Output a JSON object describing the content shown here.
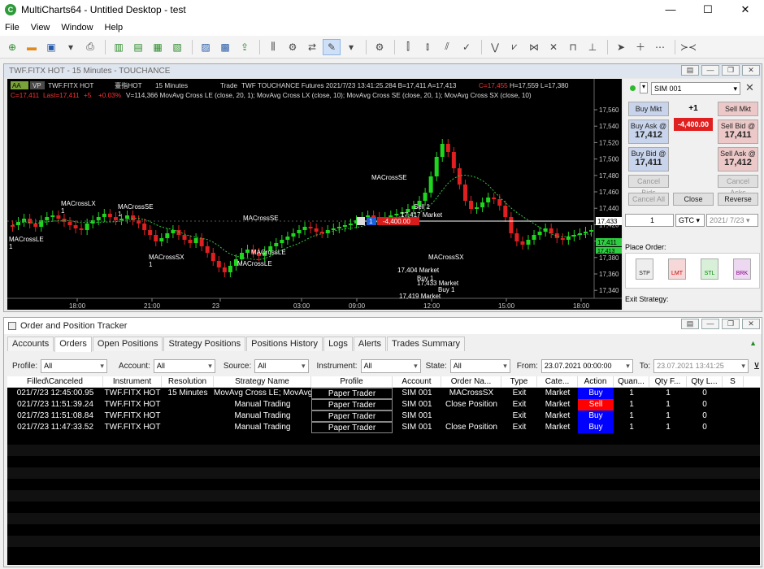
{
  "title": "MultiCharts64 - Untitled Desktop - test",
  "menu": [
    "File",
    "View",
    "Window",
    "Help"
  ],
  "chart_window": {
    "title": "TWF.FITX HOT - 15 Minutes - TOUCHANCE",
    "aa": "AA",
    "vp": "VP",
    "hdr_symbol": "TWF.FITX HOT",
    "hdr_name": "臺指HOT",
    "hdr_res": "15 Minutes",
    "hdr_trade": "Trade",
    "hdr_src": "TWF TOUCHANCE Futures 2021/7/23 13:41:25.284 B=17,411 A=17,413",
    "hdr_c": "C=17,455",
    "hdr_hl": "H=17,559 L=17,380",
    "line2_a": "C=17,411",
    "line2_b": "Last=17,411",
    "line2_c": "+5",
    "line2_d": "+0.03%",
    "line2_e": "V=114,366 MovAvg Cross LE (close, 20, 1); MovAvg Cross LX (close, 10); MovAvg Cross SE (close, 20, 1); MovAvg Cross SX (close, 10)",
    "price_ticks": [
      "17,560",
      "17,540",
      "17,520",
      "17,500",
      "17,480",
      "17,460",
      "17,440",
      "17,420",
      "17,400",
      "17,380",
      "17,360",
      "17,340"
    ],
    "time_ticks": [
      "18:00",
      "21:00",
      "23",
      "03:00",
      "09:00",
      "12:00",
      "15:00",
      "18:00"
    ],
    "last_price": "17,433",
    "bid_price": "17,411",
    "ask_price": "17,413",
    "pos_qty": "1",
    "pos_pl": "-4,400.00",
    "labels": [
      {
        "t": "MACrossLX\n1"
      },
      {
        "t": "MACrossSE\n1"
      },
      {
        "t": "MACrossLE\n1"
      },
      {
        "t": "MACrossSX\n1"
      },
      {
        "t": "MACrossSE"
      },
      {
        "t": "MACrossLE"
      },
      {
        "t": "MACrossLE"
      },
      {
        "t": "MACrossSE"
      },
      {
        "t": "Sell 1"
      },
      {
        "t": "17,417 Market"
      },
      {
        "t": "MACrossSX"
      },
      {
        "t": "17,404 Market"
      },
      {
        "t": "Buy 1"
      },
      {
        "t": "17,433 Market"
      },
      {
        "t": "Buy 1"
      },
      {
        "t": "17,419 Market"
      }
    ]
  },
  "dom": {
    "account": "SIM 001",
    "buy_mkt": "Buy Mkt",
    "sell_mkt": "Sell Mkt",
    "pos": "+1",
    "pl": "-4,400.00",
    "buy_ask": "Buy Ask @",
    "buy_ask_v": "17,412",
    "sell_bid": "Sell Bid @",
    "sell_bid_v": "17,411",
    "buy_bid": "Buy Bid @",
    "buy_bid_v": "17,411",
    "sell_ask": "Sell Ask @",
    "sell_ask_v": "17,412",
    "cancel_bids": "Cancel Bids",
    "cancel_asks": "Cancel Asks",
    "cancel_all": "Cancel All",
    "close": "Close",
    "reverse": "Reverse",
    "qty": "1",
    "tif": "GTC",
    "date": "2021/ 7/23",
    "place_order": "Place Order:",
    "order_types": [
      "STP",
      "LMT",
      "STL",
      "BRK"
    ],
    "exit_strategy": "Exit Strategy:"
  },
  "tracker": {
    "title": "Order and Position Tracker",
    "tabs": [
      "Accounts",
      "Orders",
      "Open Positions",
      "Strategy Positions",
      "Positions History",
      "Logs",
      "Alerts",
      "Trades Summary"
    ],
    "active_tab": "Orders",
    "filters": {
      "profile_lbl": "Profile:",
      "profile": "All",
      "account_lbl": "Account:",
      "account": "All",
      "source_lbl": "Source:",
      "source": "All",
      "instrument_lbl": "Instrument:",
      "instrument": "All",
      "state_lbl": "State:",
      "state": "All",
      "from_lbl": "From:",
      "from": "23.07.2021 00:00:00",
      "to_lbl": "To:",
      "to": "23.07.2021 13:41:25"
    },
    "columns": [
      "Filled\\Canceled",
      "Instrument",
      "Resolution",
      "Strategy Name",
      "Profile",
      "Account",
      "Order Na...",
      "Type",
      "Cate...",
      "Action",
      "Quan...",
      "Qty F...",
      "Qty L...",
      "S"
    ],
    "rows": [
      [
        "021/7/23 12:45:00.95",
        "TWF.FITX HOT",
        "15 Minutes",
        "MovAvg Cross LE; MovAvg",
        "Paper Trader",
        "SIM 001",
        "MACrossSX",
        "Exit",
        "Market",
        "Buy",
        "1",
        "1",
        "0"
      ],
      [
        "021/7/23 11:51:39.24",
        "TWF.FITX HOT",
        "",
        "Manual Trading",
        "Paper Trader",
        "SIM 001",
        "Close Position",
        "Exit",
        "Market",
        "Sell",
        "1",
        "1",
        "0"
      ],
      [
        "021/7/23 11:51:08.84",
        "TWF.FITX HOT",
        "",
        "Manual Trading",
        "Paper Trader",
        "SIM 001",
        "",
        "Exit",
        "Market",
        "Buy",
        "1",
        "1",
        "0"
      ],
      [
        "021/7/23 11:47:33.52",
        "TWF.FITX HOT",
        "",
        "Manual Trading",
        "Paper Trader",
        "SIM 001",
        "Close Position",
        "Exit",
        "Market",
        "Buy",
        "1",
        "1",
        "0"
      ]
    ]
  },
  "colors": {
    "up": "#1fd61f",
    "down": "#e02020",
    "buy": "#0000ff",
    "sell": "#ff0000"
  }
}
